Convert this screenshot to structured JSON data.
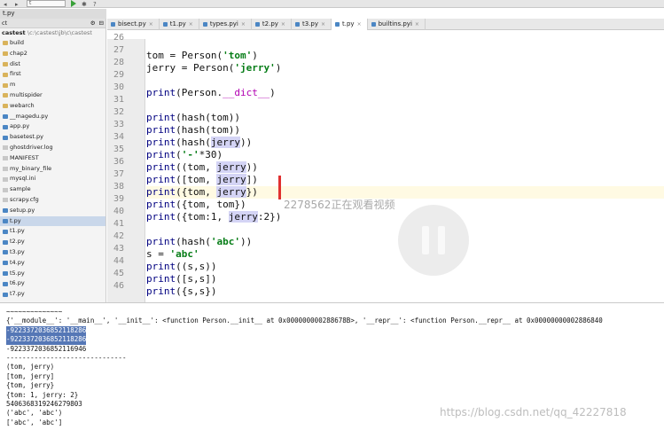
{
  "toolbar": {
    "config_value": "t"
  },
  "project_tab": "t.py",
  "sidebar": {
    "header_label": "ct",
    "root_name": "castest",
    "root_path": "\\c:\\castest\\jb\\c\\castest",
    "items": [
      {
        "label": "build",
        "kind": "folder"
      },
      {
        "label": "chap2",
        "kind": "folder"
      },
      {
        "label": "dist",
        "kind": "folder"
      },
      {
        "label": "first",
        "kind": "folder"
      },
      {
        "label": "m",
        "kind": "folder"
      },
      {
        "label": "multispider",
        "kind": "folder"
      },
      {
        "label": "webarch",
        "kind": "folder"
      },
      {
        "label": "__magedu.py",
        "kind": "py"
      },
      {
        "label": "app.py",
        "kind": "py"
      },
      {
        "label": "basetest.py",
        "kind": "py"
      },
      {
        "label": "ghostdriver.log",
        "kind": "file"
      },
      {
        "label": "MANIFEST",
        "kind": "file"
      },
      {
        "label": "my_binary_file",
        "kind": "file"
      },
      {
        "label": "mysql.ini",
        "kind": "file"
      },
      {
        "label": "sample",
        "kind": "file"
      },
      {
        "label": "scrapy.cfg",
        "kind": "file"
      },
      {
        "label": "setup.py",
        "kind": "py"
      },
      {
        "label": "t.py",
        "kind": "py"
      },
      {
        "label": "t1.py",
        "kind": "py"
      },
      {
        "label": "t2.py",
        "kind": "py"
      },
      {
        "label": "t3.py",
        "kind": "py"
      },
      {
        "label": "t4.py",
        "kind": "py"
      },
      {
        "label": "t5.py",
        "kind": "py"
      },
      {
        "label": "t6.py",
        "kind": "py"
      },
      {
        "label": "t7.py",
        "kind": "py"
      }
    ]
  },
  "editor_tabs": [
    {
      "label": "bisect.py",
      "active": false
    },
    {
      "label": "t1.py",
      "active": false
    },
    {
      "label": "types.pyi",
      "active": false
    },
    {
      "label": "t2.py",
      "active": false
    },
    {
      "label": "t3.py",
      "active": false
    },
    {
      "label": "t.py",
      "active": true
    },
    {
      "label": "builtins.pyi",
      "active": false
    }
  ],
  "code": {
    "line_numbers": [
      "26",
      "27",
      "28",
      "29",
      "30",
      "31",
      "32",
      "33",
      "34",
      "35",
      "36",
      "37",
      "38",
      "39",
      "40",
      "41",
      "42",
      "43",
      "44",
      "45",
      "46"
    ],
    "current_line": "38"
  },
  "overlay": {
    "viewer_text": "2278562正在观看视频",
    "site_watermark": "https://blog.csdn.net/qq_42227818"
  },
  "console": {
    "lines": [
      "~~~~~~~~~~~~~~",
      "{'__module__': '__main__', '__init__': <function Person.__init__ at 0x000000000288678B>, '__repr__': <function Person.__repr__ at 0x00000000002886840",
      "-9223372036852118286",
      "-9223372036852118286",
      "-9223372036852116946",
      "------------------------------",
      "(tom, jerry)",
      "[tom, jerry]",
      "{tom, jerry}",
      "{tom: 1, jerry: 2}",
      "5406368319246279803",
      "('abc', 'abc')",
      "['abc', 'abc']"
    ]
  }
}
